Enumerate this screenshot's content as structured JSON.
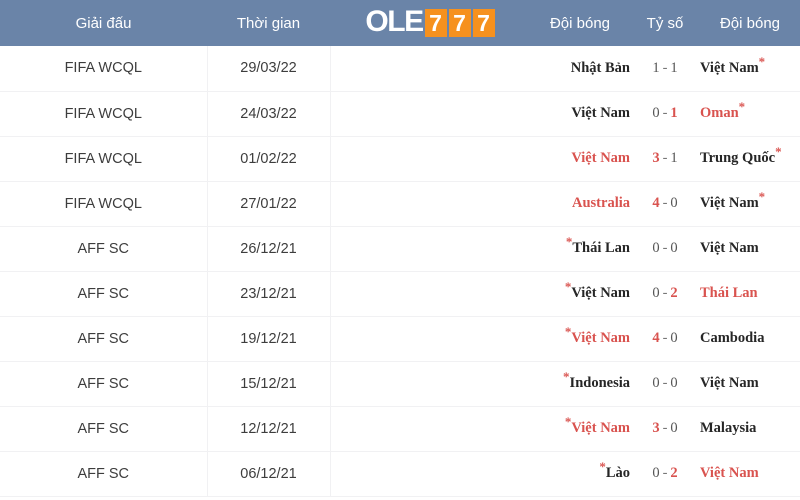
{
  "header": {
    "league_label": "Giải đấu",
    "time_label": "Thời gian",
    "home_label": "Đội bóng",
    "score_label": "Tỷ số",
    "away_label": "Đội bóng",
    "background_color": "#6a84a8",
    "text_color": "#ffffff"
  },
  "logo": {
    "text_white": "OLE",
    "digits": [
      "7",
      "7",
      "7"
    ],
    "accent_color": "#f6911e",
    "white_color": "#ffffff"
  },
  "colors": {
    "highlight_red": "#d9534f",
    "normal_text": "#262626",
    "muted_text": "#555555",
    "row_border": "#f1f1f3"
  },
  "rows": [
    {
      "league": "FIFA WCQL",
      "date": "29/03/22",
      "home": {
        "name": "Nhật Bản",
        "star_before": "",
        "star_after": "",
        "highlight": false
      },
      "score": {
        "home_goals": "1",
        "away_goals": "1",
        "home_win": false,
        "away_win": false,
        "separator": "-"
      },
      "away": {
        "name": "Việt Nam",
        "star_before": "",
        "star_after": "*",
        "highlight": false
      }
    },
    {
      "league": "FIFA WCQL",
      "date": "24/03/22",
      "home": {
        "name": "Việt Nam",
        "star_before": "",
        "star_after": "",
        "highlight": false
      },
      "score": {
        "home_goals": "0",
        "away_goals": "1",
        "home_win": false,
        "away_win": true,
        "separator": "-"
      },
      "away": {
        "name": "Oman",
        "star_before": "",
        "star_after": "*",
        "highlight": true
      }
    },
    {
      "league": "FIFA WCQL",
      "date": "01/02/22",
      "home": {
        "name": "Việt Nam",
        "star_before": "",
        "star_after": "",
        "highlight": true
      },
      "score": {
        "home_goals": "3",
        "away_goals": "1",
        "home_win": true,
        "away_win": false,
        "separator": "-"
      },
      "away": {
        "name": "Trung Quốc",
        "star_before": "",
        "star_after": "*",
        "highlight": false
      }
    },
    {
      "league": "FIFA WCQL",
      "date": "27/01/22",
      "home": {
        "name": "Australia",
        "star_before": "",
        "star_after": "",
        "highlight": true
      },
      "score": {
        "home_goals": "4",
        "away_goals": "0",
        "home_win": true,
        "away_win": false,
        "separator": "-"
      },
      "away": {
        "name": "Việt Nam",
        "star_before": "",
        "star_after": "*",
        "highlight": false
      }
    },
    {
      "league": "AFF SC",
      "date": "26/12/21",
      "home": {
        "name": "Thái Lan",
        "star_before": "*",
        "star_after": "",
        "highlight": false
      },
      "score": {
        "home_goals": "0",
        "away_goals": "0",
        "home_win": false,
        "away_win": false,
        "separator": "-"
      },
      "away": {
        "name": "Việt Nam",
        "star_before": "",
        "star_after": "",
        "highlight": false
      }
    },
    {
      "league": "AFF SC",
      "date": "23/12/21",
      "home": {
        "name": "Việt Nam",
        "star_before": "*",
        "star_after": "",
        "highlight": false
      },
      "score": {
        "home_goals": "0",
        "away_goals": "2",
        "home_win": false,
        "away_win": true,
        "separator": "-"
      },
      "away": {
        "name": "Thái Lan",
        "star_before": "",
        "star_after": "",
        "highlight": true
      }
    },
    {
      "league": "AFF SC",
      "date": "19/12/21",
      "home": {
        "name": "Việt Nam",
        "star_before": "*",
        "star_after": "",
        "highlight": true
      },
      "score": {
        "home_goals": "4",
        "away_goals": "0",
        "home_win": true,
        "away_win": false,
        "separator": "-"
      },
      "away": {
        "name": "Cambodia",
        "star_before": "",
        "star_after": "",
        "highlight": false
      }
    },
    {
      "league": "AFF SC",
      "date": "15/12/21",
      "home": {
        "name": "Indonesia",
        "star_before": "*",
        "star_after": "",
        "highlight": false
      },
      "score": {
        "home_goals": "0",
        "away_goals": "0",
        "home_win": false,
        "away_win": false,
        "separator": "-"
      },
      "away": {
        "name": "Việt Nam",
        "star_before": "",
        "star_after": "",
        "highlight": false
      }
    },
    {
      "league": "AFF SC",
      "date": "12/12/21",
      "home": {
        "name": "Việt Nam",
        "star_before": "*",
        "star_after": "",
        "highlight": true
      },
      "score": {
        "home_goals": "3",
        "away_goals": "0",
        "home_win": true,
        "away_win": false,
        "separator": "-"
      },
      "away": {
        "name": "Malaysia",
        "star_before": "",
        "star_after": "",
        "highlight": false
      }
    },
    {
      "league": "AFF SC",
      "date": "06/12/21",
      "home": {
        "name": "Lào",
        "star_before": "*",
        "star_after": "",
        "highlight": false
      },
      "score": {
        "home_goals": "0",
        "away_goals": "2",
        "home_win": false,
        "away_win": true,
        "separator": "-"
      },
      "away": {
        "name": "Việt Nam",
        "star_before": "",
        "star_after": "",
        "highlight": true
      }
    }
  ]
}
